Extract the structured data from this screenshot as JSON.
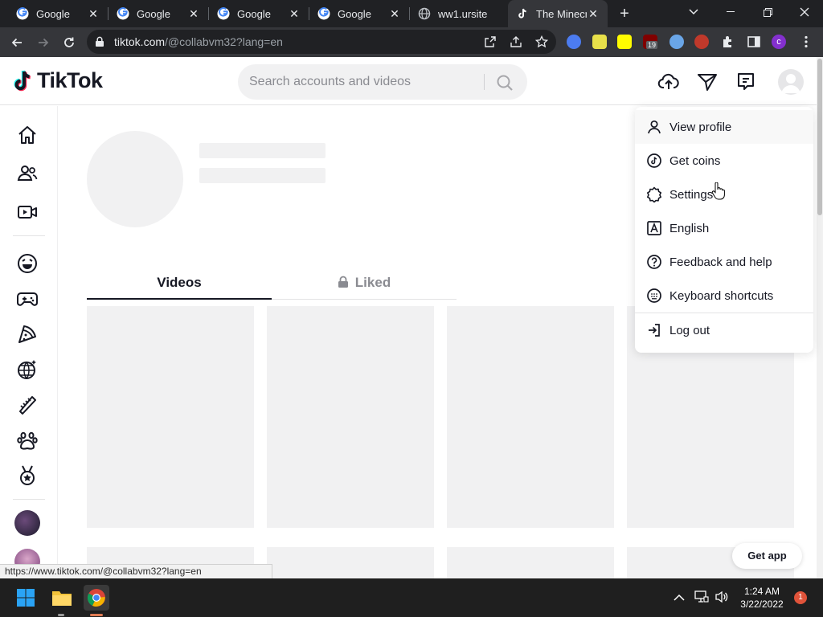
{
  "browser": {
    "tabs": [
      {
        "title": "Google",
        "favicon": "google-icon"
      },
      {
        "title": "Google",
        "favicon": "google-icon"
      },
      {
        "title": "Google",
        "favicon": "google-icon"
      },
      {
        "title": "Google",
        "favicon": "google-icon"
      },
      {
        "title": "ww1.ursite",
        "favicon": "globe-icon"
      },
      {
        "title": "The Minecr",
        "favicon": "tiktok-icon"
      }
    ],
    "url_host": "tiktok.com",
    "url_path": "/@collabvm32?lang=en",
    "extension_badge": "19",
    "profile_initial": "c",
    "status_url": "https://www.tiktok.com/@collabvm32?lang=en"
  },
  "site": {
    "logo_text": "TikTok",
    "search_placeholder": "Search accounts and videos"
  },
  "profile": {
    "tabs": [
      {
        "label": "Videos",
        "active": true
      },
      {
        "label": "Liked",
        "active": false,
        "locked": true
      }
    ]
  },
  "menu": {
    "items": [
      {
        "label": "View profile",
        "icon": "person-icon"
      },
      {
        "label": "Get coins",
        "icon": "tiktok-coin-icon"
      },
      {
        "label": "Settings",
        "icon": "gear-icon"
      },
      {
        "label": "English",
        "icon": "language-icon"
      },
      {
        "label": "Feedback and help",
        "icon": "help-icon"
      },
      {
        "label": "Keyboard shortcuts",
        "icon": "keyboard-icon"
      },
      {
        "label": "Log out",
        "icon": "logout-icon"
      }
    ]
  },
  "get_app_label": "Get app",
  "taskbar": {
    "time": "1:24 AM",
    "date": "3/22/2022",
    "notification_count": "1"
  },
  "colors": {
    "tiktok_dark": "#161823",
    "chrome_dark": "#202124",
    "toolbar": "#35363a",
    "skeleton": "#f1f1f2"
  }
}
